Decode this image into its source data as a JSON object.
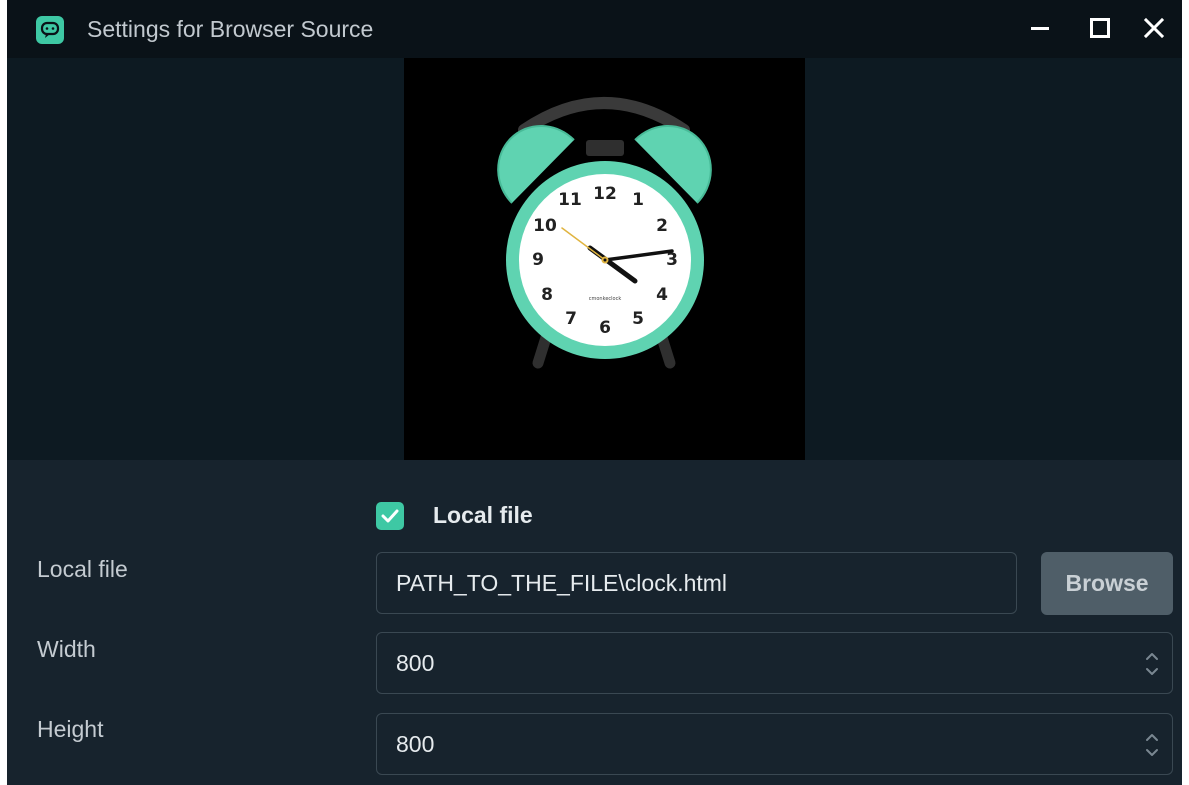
{
  "window": {
    "title": "Settings for Browser Source"
  },
  "preview": {
    "clock": {
      "numbers": [
        "12",
        "1",
        "2",
        "3",
        "4",
        "5",
        "6",
        "7",
        "8",
        "9",
        "10",
        "11"
      ],
      "brand": "cmonkeclock",
      "accent_color": "#5fd3b1"
    }
  },
  "form": {
    "local_file_checkbox": {
      "label": "Local file",
      "checked": true
    },
    "local_file": {
      "label": "Local file",
      "value": "PATH_TO_THE_FILE\\clock.html",
      "browse_label": "Browse"
    },
    "width": {
      "label": "Width",
      "value": "800"
    },
    "height": {
      "label": "Height",
      "value": "800"
    }
  },
  "colors": {
    "accent": "#3ec8a4",
    "background": "#17232d",
    "titlebar": "#0a1218"
  }
}
